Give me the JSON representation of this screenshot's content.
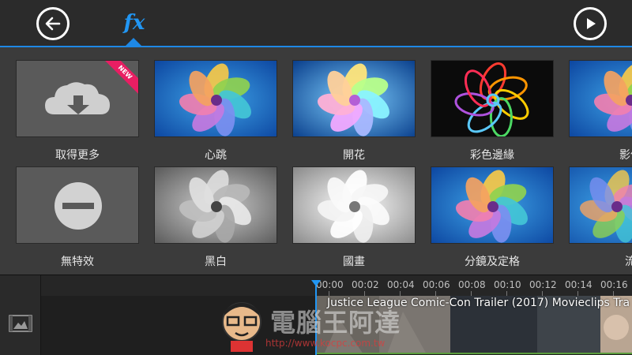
{
  "header": {
    "back_icon": "back-arrow-icon",
    "fx_label": "fx",
    "play_icon": "play-icon",
    "accent": "#1e88e5"
  },
  "effects": [
    {
      "label": "取得更多",
      "thumb": "cloud-download",
      "badge": "NEW"
    },
    {
      "label": "心跳",
      "thumb": "pinwheel-color"
    },
    {
      "label": "開花",
      "thumb": "pinwheel-glow"
    },
    {
      "label": "彩色邊緣",
      "thumb": "pinwheel-edges"
    },
    {
      "label": "影像",
      "thumb": "pinwheel-color"
    },
    {
      "label": "無特效",
      "thumb": "no-entry"
    },
    {
      "label": "黑白",
      "thumb": "pinwheel-gray"
    },
    {
      "label": "國畫",
      "thumb": "pinwheel-white"
    },
    {
      "label": "分鏡及定格",
      "thumb": "pinwheel-color"
    },
    {
      "label": "流",
      "thumb": "pinwheel-spiral"
    }
  ],
  "timeline": {
    "media_icon": "media-library-icon",
    "ticks": [
      "00:00",
      "00:02",
      "00:04",
      "00:06",
      "00:08",
      "00:10",
      "00:12",
      "00:14",
      "00:16"
    ],
    "clip_title": "Justice League Comic-Con Trailer (2017)  Movieclips Tra"
  },
  "watermark": {
    "text": "電腦王阿達",
    "url": "http://www.kocpc.com.tw"
  }
}
